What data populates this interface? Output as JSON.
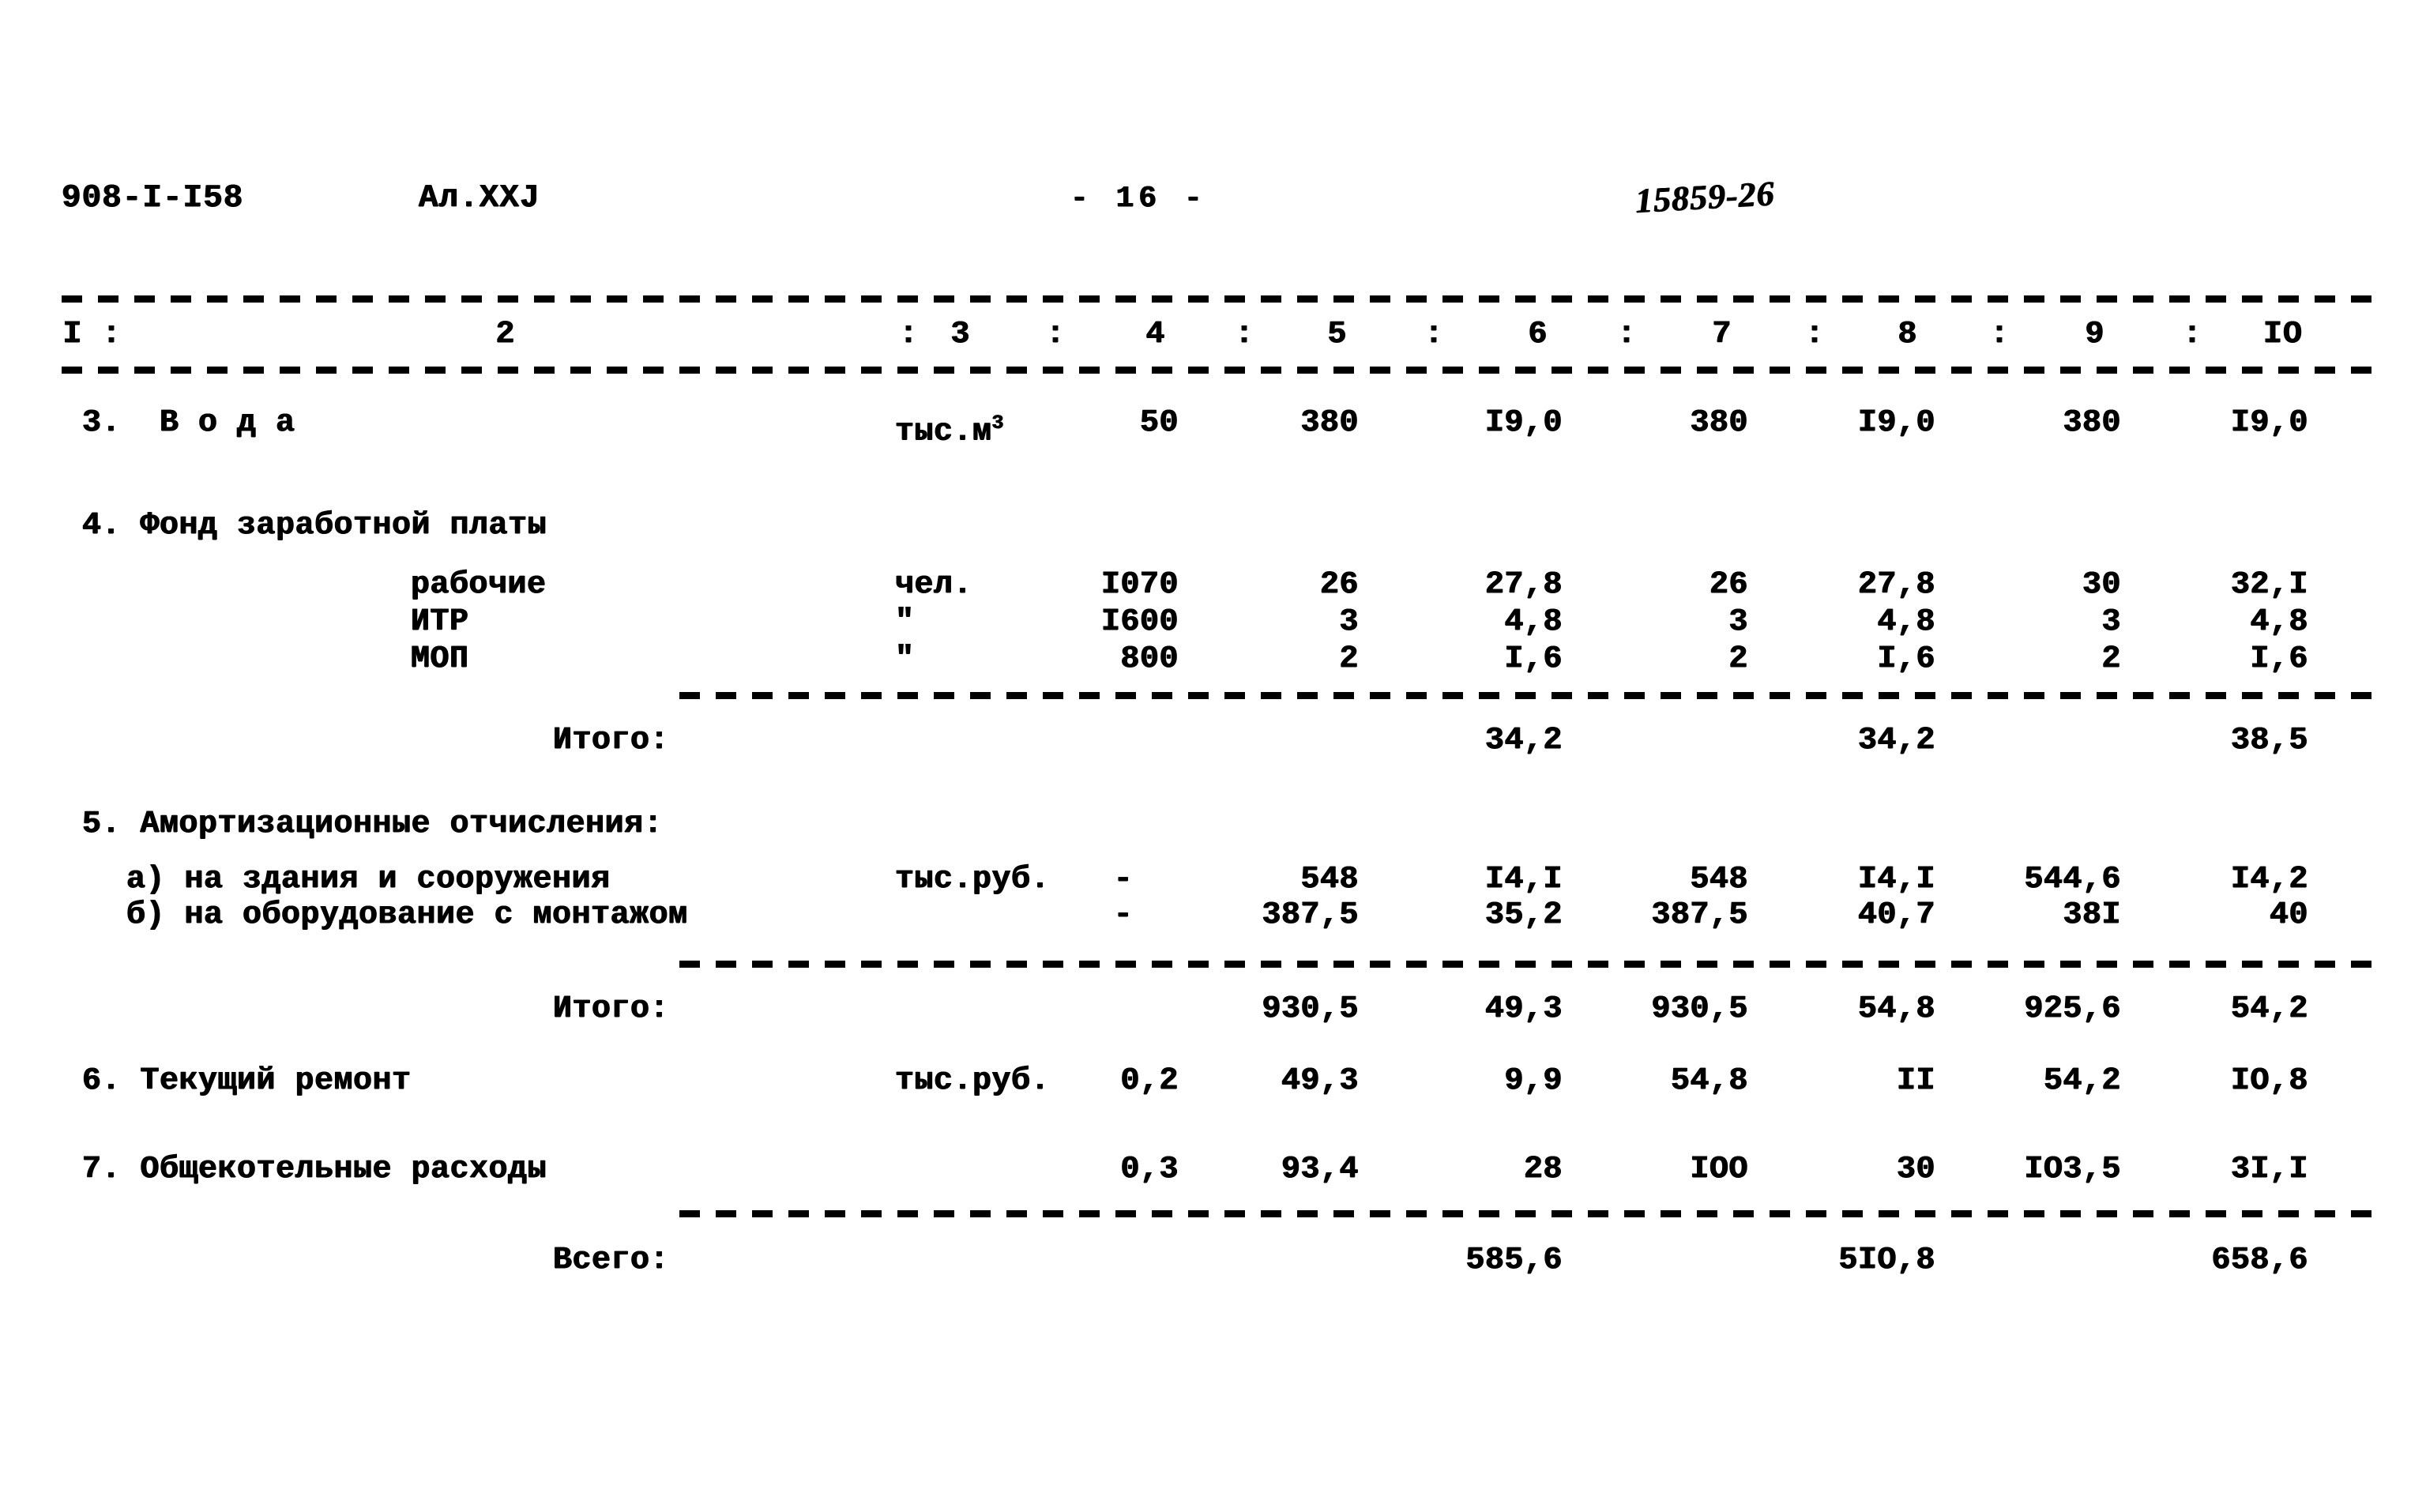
{
  "document": {
    "code": "908-I-I58",
    "album": "Ал.XXJ",
    "page_marker": "-  16  -",
    "archive_stamp": "15859-26"
  },
  "table": {
    "column_headers": [
      "I",
      "2",
      "3",
      "4",
      "5",
      "6",
      "7",
      "8",
      "9",
      "IO"
    ],
    "separator": ":",
    "rows": [
      {
        "name": "row-water",
        "label": "3.  В о д а",
        "unit": "тыс.м",
        "unit_sup": "3",
        "c4": "50",
        "c5": "380",
        "c6": "I9,0",
        "c7": "380",
        "c8": "I9,0",
        "c9": "380",
        "c10": "I9,0"
      },
      {
        "name": "row-payroll-workers",
        "label": "рабочие",
        "unit": "чел.",
        "c4": "I070",
        "c5": "26",
        "c6": "27,8",
        "c7": "26",
        "c8": "27,8",
        "c9": "30",
        "c10": "32,I"
      },
      {
        "name": "row-payroll-itr",
        "label": "ИТР",
        "unit": "\"",
        "c4": "I600",
        "c5": "3",
        "c6": "4,8",
        "c7": "3",
        "c8": "4,8",
        "c9": "3",
        "c10": "4,8"
      },
      {
        "name": "row-payroll-mop",
        "label": "МОП",
        "unit": "\"",
        "c4": "800",
        "c5": "2",
        "c6": "I,6",
        "c7": "2",
        "c8": "I,6",
        "c9": "2",
        "c10": "I,6"
      },
      {
        "name": "row-amort-buildings",
        "label": "а) на здания и сооружения",
        "unit": "тыс.руб.",
        "c4": "-",
        "c5": "548",
        "c6": "I4,I",
        "c7": "548",
        "c8": "I4,I",
        "c9": "544,6",
        "c10": "I4,2"
      },
      {
        "name": "row-amort-equipment",
        "label": "б) на оборудование с монтажом",
        "unit": "",
        "c4": "-",
        "c5": "387,5",
        "c6": "35,2",
        "c7": "387,5",
        "c8": "40,7",
        "c9": "38I",
        "c10": "40"
      },
      {
        "name": "row-current-repair",
        "label": "6. Текущий ремонт",
        "unit": "тыс.руб.",
        "c4": "0,2",
        "c5": "49,3",
        "c6": "9,9",
        "c7": "54,8",
        "c8": "II",
        "c9": "54,2",
        "c10": "IO,8"
      },
      {
        "name": "row-general-boiler-costs",
        "label": "7. Общекотельные расходы",
        "unit": "",
        "c4": "0,3",
        "c5": "93,4",
        "c6": "28",
        "c7": "IOO",
        "c8": "30",
        "c9": "IO3,5",
        "c10": "3I,I"
      }
    ],
    "section_headings": {
      "payroll": "4. Фонд заработной платы",
      "amortization": "5. Амортизационные отчисления:"
    },
    "subtotals": [
      {
        "name": "subtotal-payroll",
        "label": "Итого:",
        "c6": "34,2",
        "c8": "34,2",
        "c10": "38,5"
      },
      {
        "name": "subtotal-amortization",
        "label": "Итого:",
        "c5": "930,5",
        "c6": "49,3",
        "c7": "930,5",
        "c8": "54,8",
        "c9": "925,6",
        "c10": "54,2"
      }
    ],
    "grand_total": {
      "name": "grand-total",
      "label": "Всего:",
      "c6": "585,6",
      "c8": "5IO,8",
      "c10": "658,6"
    }
  },
  "colors": {
    "ink": "#000000",
    "paper": "#ffffff"
  }
}
